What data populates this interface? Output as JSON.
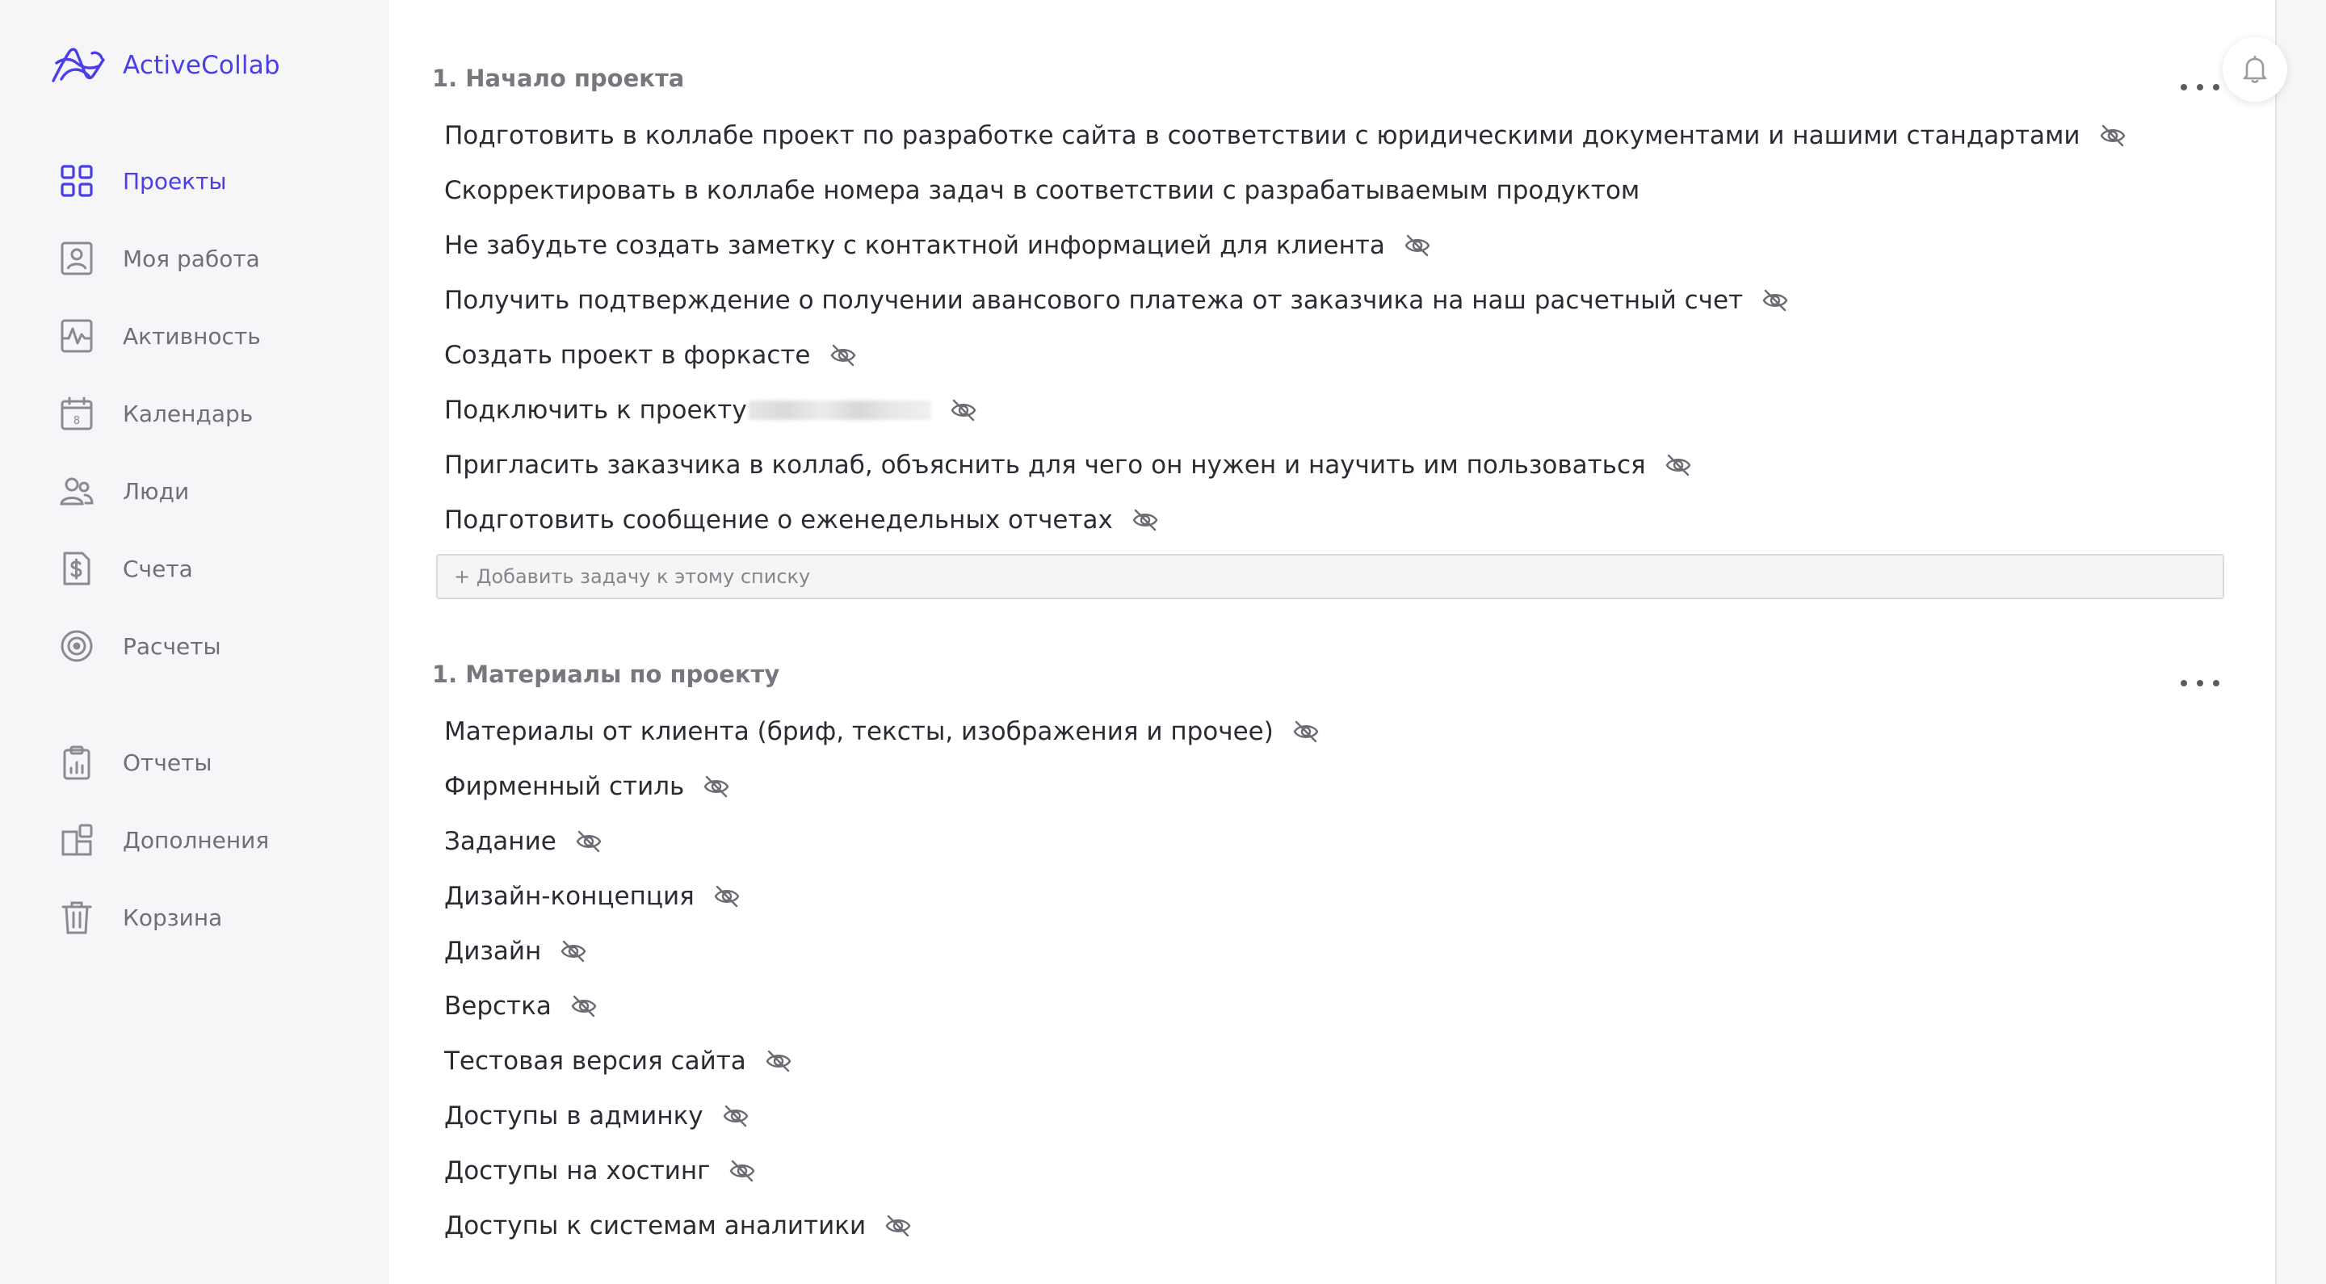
{
  "app": {
    "logo_text": "ActiveCollab"
  },
  "sidebar": {
    "items": [
      {
        "label": "Проекты",
        "icon": "grid-icon",
        "active": true
      },
      {
        "label": "Моя работа",
        "icon": "user-card-icon"
      },
      {
        "label": "Активность",
        "icon": "activity-icon"
      },
      {
        "label": "Календарь",
        "icon": "calendar-icon",
        "icon_text": "8"
      },
      {
        "label": "Люди",
        "icon": "people-icon"
      },
      {
        "label": "Счета",
        "icon": "invoice-icon"
      },
      {
        "label": "Расчеты",
        "icon": "target-icon"
      },
      {
        "label": "Отчеты",
        "icon": "clipboard-icon"
      },
      {
        "label": "Дополнения",
        "icon": "addons-icon"
      },
      {
        "label": "Корзина",
        "icon": "trash-icon"
      }
    ]
  },
  "colors": {
    "accent": "#4a3ee8",
    "nav_text": "#6f6f7a",
    "task_text": "#2b2b33",
    "list_title": "#77777f"
  },
  "lists": [
    {
      "title": "1. Начало проекта",
      "tasks": [
        {
          "text": "Подготовить в коллабе проект по разработке сайта в соответствии с юридическими документами и нашими стандартами",
          "hidden_from_client": true
        },
        {
          "text": "Скорректировать в коллабе номера задач в соответствии с разрабатываемым продуктом",
          "hidden_from_client": false
        },
        {
          "text": "Не забудьте создать заметку с контактной информацией для клиента",
          "hidden_from_client": true
        },
        {
          "text": "Получить подтверждение о получении авансового платежа от заказчика на наш расчетный счет",
          "hidden_from_client": true
        },
        {
          "text": "Создать проект в форкасте",
          "hidden_from_client": true
        },
        {
          "text": "Подключить к проекту",
          "hidden_from_client": true,
          "redacted": true
        },
        {
          "text": "Пригласить заказчика в коллаб, объяснить для чего он нужен и научить им пользоваться",
          "hidden_from_client": true
        },
        {
          "text": "Подготовить сообщение о еженедельных отчетах",
          "hidden_from_client": true
        }
      ],
      "add_task_placeholder": "+ Добавить задачу к этому списку"
    },
    {
      "title": "1. Материалы по проекту",
      "tasks": [
        {
          "text": "Материалы от клиента (бриф, тексты, изображения и прочее)",
          "hidden_from_client": true
        },
        {
          "text": "Фирменный стиль",
          "hidden_from_client": true
        },
        {
          "text": "Задание",
          "hidden_from_client": true
        },
        {
          "text": "Дизайн-концепция",
          "hidden_from_client": true
        },
        {
          "text": "Дизайн",
          "hidden_from_client": true
        },
        {
          "text": "Верстка",
          "hidden_from_client": true
        },
        {
          "text": "Тестовая версия сайта",
          "hidden_from_client": true
        },
        {
          "text": "Доступы в админку",
          "hidden_from_client": true
        },
        {
          "text": "Доступы на хостинг",
          "hidden_from_client": true
        },
        {
          "text": "Доступы к системам аналитики",
          "hidden_from_client": true
        }
      ]
    }
  ]
}
